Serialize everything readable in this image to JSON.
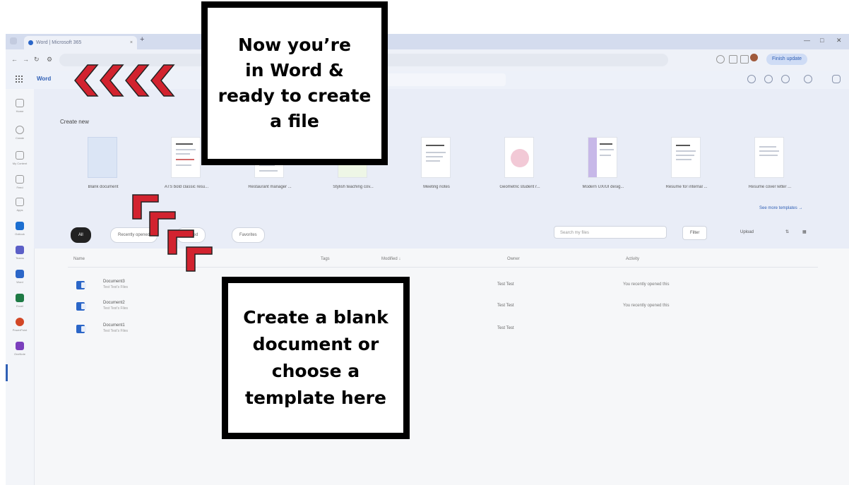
{
  "browser": {
    "tab_title": "Word | Microsoft 365",
    "tab_close": "×",
    "new_tab": "+",
    "url": "",
    "profile_button": "Finish update"
  },
  "app": {
    "name": "Word"
  },
  "rail": {
    "items": [
      "Home",
      "Create",
      "My Content",
      "Feed",
      "Apps",
      "Outlook",
      "Teams",
      "Word",
      "Excel",
      "PowerPoint",
      "OneNote"
    ]
  },
  "create": {
    "title": "Create new",
    "templates": [
      "Blank document",
      "ATS bold classic resu...",
      "Restaurant manager ...",
      "Stylish teaching cov...",
      "Meeting notes",
      "Geometric student r...",
      "Modern UX/UI desig...",
      "Resume for internal ...",
      "Resume cover letter ..."
    ],
    "see_more": "See more templates →"
  },
  "files": {
    "filters": [
      "All",
      "Recently opened",
      "Shared",
      "Favorites"
    ],
    "search_placeholder": "Search my files",
    "filter_button": "Filter",
    "upload_button": "Upload",
    "columns": [
      "Name",
      "Tags",
      "Modified ↓",
      "Owner",
      "Activity"
    ],
    "rows": [
      {
        "name": "Document3",
        "sub": "Test Test's Files",
        "modified": "",
        "owner": "Test Test",
        "activity": "You recently opened this"
      },
      {
        "name": "Document2",
        "sub": "Test Test's Files",
        "modified": "",
        "owner": "Test Test",
        "activity": "You recently opened this"
      },
      {
        "name": "Document1",
        "sub": "Test Test's Files",
        "modified": "",
        "owner": "Test Test",
        "activity": ""
      }
    ]
  },
  "callouts": {
    "top": [
      "Now you’re",
      "in Word &",
      "ready to create",
      "a file"
    ],
    "bottom": [
      "Create a blank",
      "document or",
      "choose a",
      "template here"
    ]
  },
  "colors": {
    "arrow_red": "#d2232f",
    "accent_blue": "#2f5fb5",
    "create_bg": "#e9edf7"
  }
}
